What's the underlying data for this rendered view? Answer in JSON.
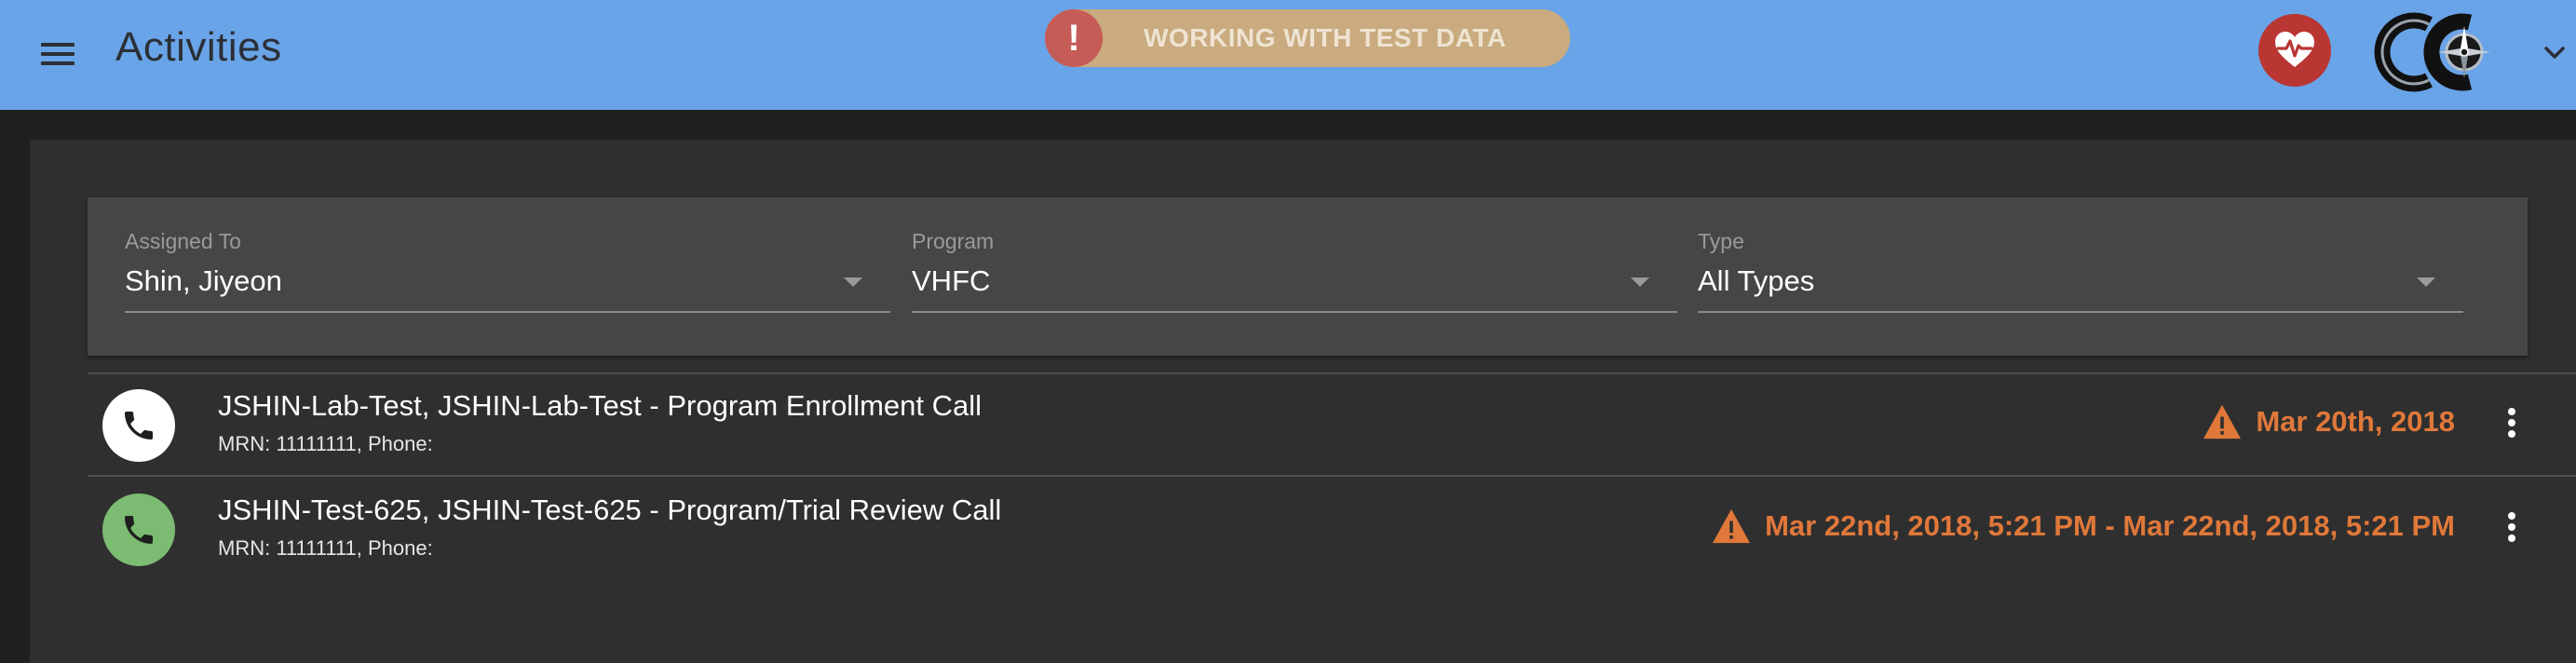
{
  "appbar": {
    "title": "Activities",
    "test_banner": "WORKING WITH TEST DATA",
    "test_banner_icon": "!",
    "color": "#6aa4e8"
  },
  "filters": {
    "assigned_to": {
      "label": "Assigned To",
      "value": "Shin, Jiyeon"
    },
    "program": {
      "label": "Program",
      "value": "VHFC"
    },
    "type": {
      "label": "Type",
      "value": "All Types"
    }
  },
  "activities": [
    {
      "title": "JSHIN-Lab-Test, JSHIN-Lab-Test - Program Enrollment Call",
      "subtitle": "MRN: 11111111, Phone:",
      "date": "Mar 20th, 2018",
      "avatar_color": "#ffffff",
      "icon_color": "#1f1f1f",
      "icon": "phone-icon"
    },
    {
      "title": "JSHIN-Test-625, JSHIN-Test-625 - Program/Trial Review Call",
      "subtitle": "MRN: 11111111, Phone:",
      "date": "Mar 22nd, 2018, 5:21 PM - Mar 22nd, 2018, 5:21 PM",
      "avatar_color": "#7cbb72",
      "icon_color": "#1f1f1f",
      "icon": "phone-icon"
    }
  ],
  "colors": {
    "warning": "#e0783a",
    "heart_button": "#b93632",
    "panel": "#2f2f2f",
    "filter_card": "#464646"
  }
}
